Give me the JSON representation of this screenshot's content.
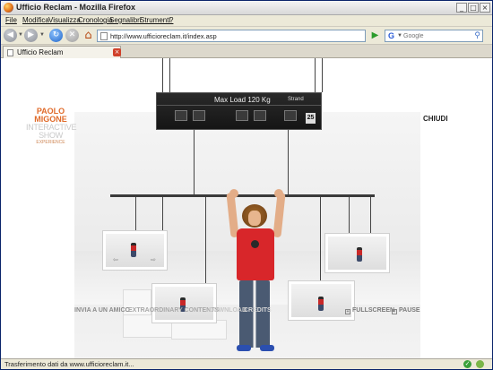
{
  "window": {
    "title": "Ufficio Reclam - Mozilla Firefox",
    "controls": {
      "minimize": "_",
      "maximize": "□",
      "close": "×"
    }
  },
  "menu": [
    {
      "label": "File"
    },
    {
      "label": "Modifica"
    },
    {
      "label": "Visualizza"
    },
    {
      "label": "Cronologia"
    },
    {
      "label": "Segnalibri"
    },
    {
      "label": "Strumenti"
    },
    {
      "label": "?"
    }
  ],
  "navigation": {
    "url": "http://www.ufficioreclam.it/index.asp",
    "search_placeholder": "Google",
    "search_engine_glyph": "G",
    "icons": [
      "back-icon",
      "forward-icon",
      "reload-icon",
      "stop-icon",
      "home-icon",
      "go-icon",
      "search-icon"
    ]
  },
  "tabs": [
    {
      "label": "Ufficio Reclam",
      "active": true,
      "close": "×"
    }
  ],
  "page": {
    "logo": {
      "line1": "PAOLO",
      "line2": "MIGONE",
      "line3": "INTERACTIVE",
      "line4": "SHOW",
      "line5": "EXPERIENCE"
    },
    "close_label": "CHIUDI",
    "sign": {
      "text": "Max Load 120 Kg",
      "brand": "Strand",
      "number": "25"
    },
    "bottom_nav": [
      {
        "label": "INVIA A UN AMICO"
      },
      {
        "label": "EXTRAORDINARY CONTENTS"
      },
      {
        "label": "DOWNLOAD"
      },
      {
        "label": "CREDITS"
      }
    ],
    "controls": [
      {
        "label": "FULLSCREEN",
        "icon": "+"
      },
      {
        "label": "PAUSE",
        "icon": "×"
      }
    ]
  },
  "status": {
    "text": "Trasferimento dati da www.ufficioreclam.it..."
  },
  "colors": {
    "accent_orange": "#e06b2a",
    "shirt_red": "#d8262a",
    "tab_close_red": "#d0402a"
  }
}
